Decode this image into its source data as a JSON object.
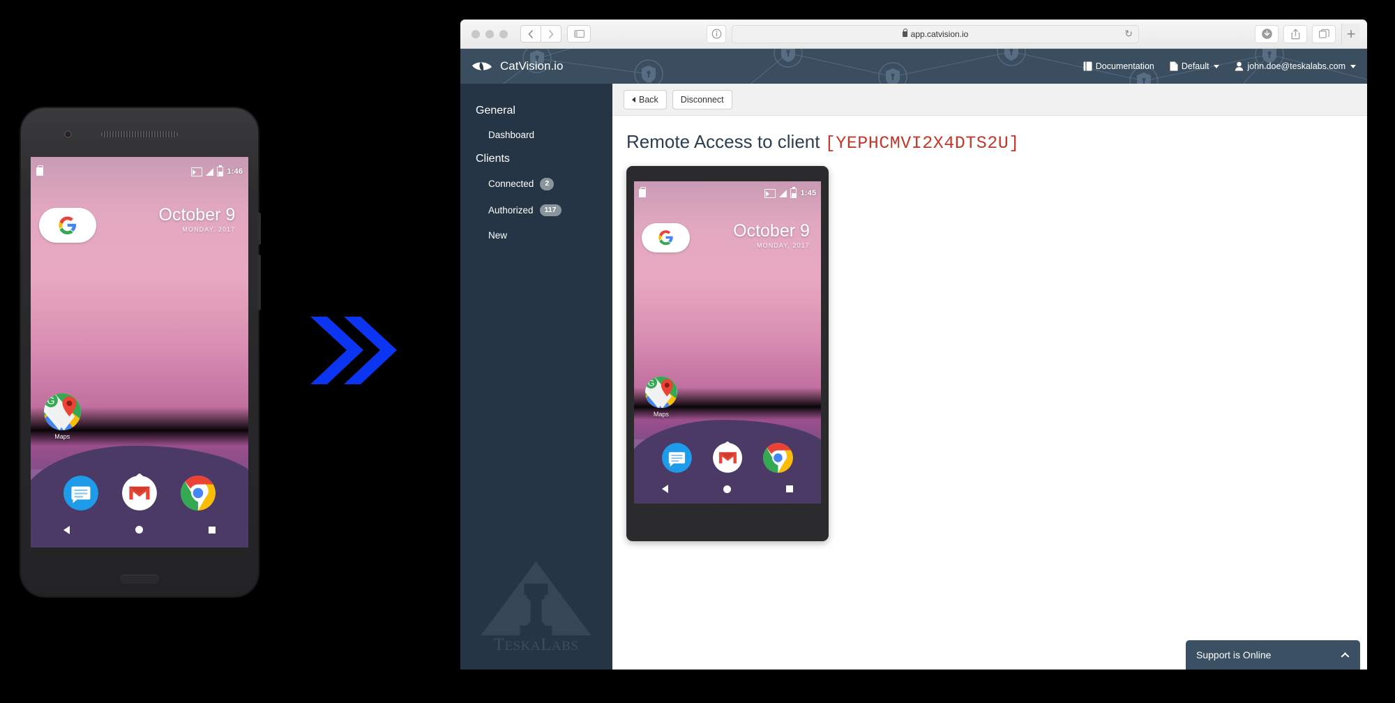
{
  "browser": {
    "url": "app.catvision.io",
    "secure_icon": "lock-icon",
    "reload_icon": "reload-icon",
    "back_icon": "chevron-left-icon",
    "forward_icon": "chevron-right-icon",
    "sidebar_icon": "sidebar-toggle-icon",
    "info_icon": "info-icon",
    "download_icon": "download-icon",
    "share_icon": "share-icon",
    "tabs_icon": "tab-overview-icon",
    "new_tab_label": "+"
  },
  "app": {
    "brand": "CatVision.io",
    "brand_icon": "cat-eye-logo",
    "nav_right": [
      {
        "label": "Documentation",
        "icon": "book-icon",
        "caret": false
      },
      {
        "label": "Default",
        "icon": "document-icon",
        "caret": true
      },
      {
        "label": "john.doe@teskalabs.com",
        "icon": "user-icon",
        "caret": true
      }
    ]
  },
  "sidebar": {
    "sections": [
      {
        "title": "General",
        "items": [
          {
            "label": "Dashboard",
            "badge": null
          }
        ]
      },
      {
        "title": "Clients",
        "items": [
          {
            "label": "Connected",
            "badge": "2"
          },
          {
            "label": "Authorized",
            "badge": "117"
          },
          {
            "label": "New",
            "badge": null
          }
        ]
      }
    ],
    "watermark": "TESKALABS"
  },
  "toolbar": {
    "back_label": "Back",
    "disconnect_label": "Disconnect"
  },
  "main": {
    "title_prefix": "Remote Access to client",
    "client_id": "[YEPHCMVI2X4DTS2U]"
  },
  "support": {
    "label": "Support is Online",
    "chevron_icon": "chevron-up-icon"
  },
  "phone_device": {
    "status_time": "1:46",
    "status_icons": [
      "bag-icon",
      "cast-icon",
      "signal-icon",
      "battery-icon"
    ],
    "date_main": "October 9",
    "date_sub": "MONDAY, 2017",
    "search_icon": "google-g-icon",
    "app_label": "Maps",
    "app_icon": "google-maps-icon",
    "dock_icons": [
      "messages-icon",
      "gmail-icon",
      "chrome-icon"
    ],
    "nav_icons": [
      "back-triangle-icon",
      "home-circle-icon",
      "recents-square-icon"
    ],
    "drawer_icon": "chevron-up-icon"
  },
  "phone_remote": {
    "status_time": "1:45",
    "status_icons": [
      "bag-icon",
      "cast-icon",
      "signal-icon",
      "battery-icon"
    ],
    "date_main": "October 9",
    "date_sub": "MONDAY, 2017",
    "search_icon": "google-g-icon",
    "app_label": "Maps",
    "app_icon": "google-maps-icon",
    "dock_icons": [
      "messages-icon",
      "gmail-icon",
      "chrome-icon"
    ],
    "nav_icons": [
      "back-triangle-icon",
      "home-circle-icon",
      "recents-square-icon"
    ],
    "drawer_icon": "chevron-up-icon"
  },
  "arrow": {
    "icon": "double-chevron-right-icon",
    "color": "#0b35f0"
  },
  "colors": {
    "navbar": "#3b4e60",
    "sidebar": "#263545",
    "client_id": "#c0392b",
    "title": "#2c3e50",
    "support": "#3c5064",
    "badge": "#8a949c"
  }
}
